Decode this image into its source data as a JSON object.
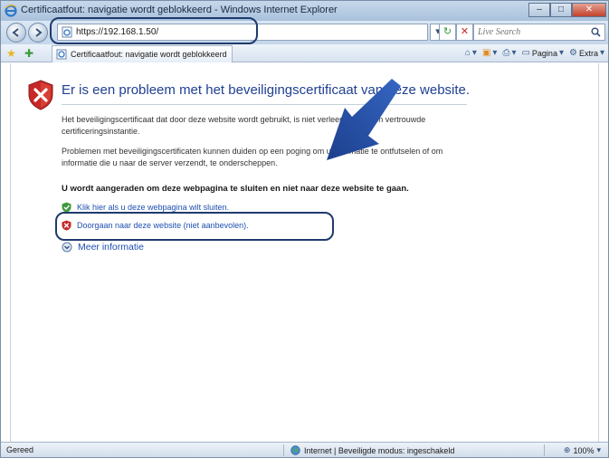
{
  "window": {
    "title": "Certificaatfout: navigatie wordt geblokkeerd - Windows Internet Explorer",
    "minimize_label": "–",
    "maximize_label": "□",
    "close_label": "✕"
  },
  "addressbar": {
    "url": "https://192.168.1.50/",
    "refresh_glyph": "↻",
    "stop_glyph": "✕",
    "go_glyph": "▾"
  },
  "search": {
    "placeholder": "Live Search"
  },
  "tab": {
    "label": "Certificaatfout: navigatie wordt geblokkeerd"
  },
  "command_bar": {
    "items": [
      {
        "icon": "home-icon",
        "label": ""
      },
      {
        "icon": "feeds-icon",
        "label": ""
      },
      {
        "icon": "print-icon",
        "label": ""
      },
      {
        "icon": "page-icon",
        "label": "Pagina"
      },
      {
        "icon": "tools-icon",
        "label": "Extra"
      }
    ]
  },
  "page": {
    "heading": "Er is een probleem met het beveiligingscertificaat van deze website.",
    "paragraph1": "Het beveiligingscertificaat dat door deze website wordt gebruikt, is niet verleend door een vertrouwde certificeringsinstantie.",
    "paragraph2": "Problemen met beveiligingscertificaten kunnen duiden op een poging om u informatie te ontfutselen of om informatie die u naar de server verzendt, te onderscheppen.",
    "recommendation": "U wordt aangeraden om deze webpagina te sluiten en niet naar deze website te gaan.",
    "link_close": "Klik hier als u deze webpagina wilt sluiten.",
    "link_continue": "Doorgaan naar deze website (niet aanbevolen).",
    "link_more": "Meer informatie"
  },
  "statusbar": {
    "status": "Gereed",
    "zone": "Internet | Beveiligde modus: ingeschakeld",
    "zoom": "100%"
  },
  "colors": {
    "heading_blue": "#1f3f93",
    "link_blue": "#1f4fb0",
    "error_red": "#c62828",
    "callout_navy": "#1f3a6e"
  }
}
